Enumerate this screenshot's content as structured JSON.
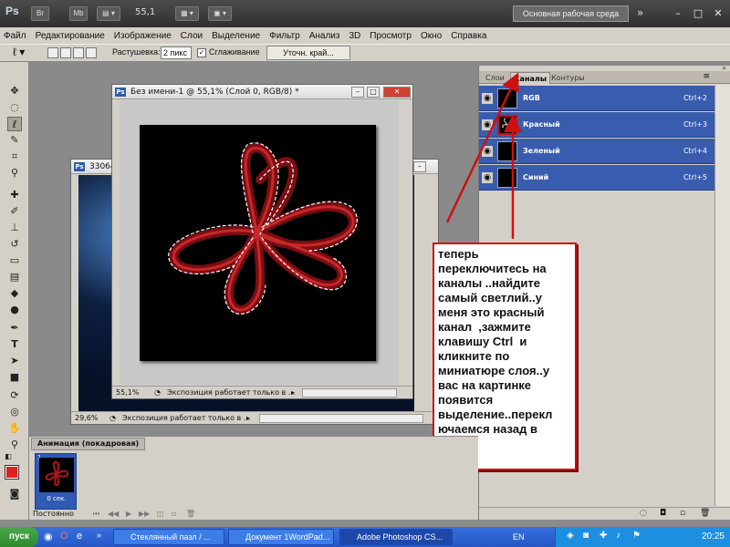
{
  "colors": {
    "accent_red": "#cc1111",
    "channel_blue": "#3a5cae"
  },
  "appbar": {
    "logo": "Ps",
    "bridge_btn": "Br",
    "minibridge_btn": "Mb",
    "zoom": "55,1",
    "workspace": "Основная рабочая среда",
    "more": "»"
  },
  "menu": [
    "Файл",
    "Редактирование",
    "Изображение",
    "Слои",
    "Выделение",
    "Фильтр",
    "Анализ",
    "3D",
    "Просмотр",
    "Окно",
    "Справка"
  ],
  "options": {
    "feather_label": "Растушевка:",
    "feather_value": "2 пикс",
    "antialias_label": "Сглаживание",
    "refine_edge": "Уточн. край..."
  },
  "doc_front": {
    "title": "Без имени-1 @ 55,1% (Слой 0, RGB/8) *",
    "zoom": "55,1%",
    "status": "Экспозиция работает только в ..."
  },
  "doc_back": {
    "title": "33064",
    "zoom": "29,6%",
    "status": "Экспозиция работает только в ..."
  },
  "panel": {
    "tabs": [
      "Слои",
      "Каналы",
      "Контуры"
    ],
    "channels": [
      {
        "name": "RGB",
        "shortcut": "Ctrl+2"
      },
      {
        "name": "Красный",
        "shortcut": "Ctrl+3"
      },
      {
        "name": "Зеленый",
        "shortcut": "Ctrl+4"
      },
      {
        "name": "Синий",
        "shortcut": "Ctrl+5"
      }
    ]
  },
  "callout": {
    "text": "теперь\nпереключитесь на\nканалы ..найдите\nсамый светлий..у\nменя это красный\nканал  ,зажмите\nклавишу Ctrl  и\nкликните по\nминиатюре слоя..у\nвас на картинке\nпоявится\nвыделение..перекл\nючаемся назад в\nслои"
  },
  "animation": {
    "tab": "Анимация (покадровая)",
    "frame_number": "1",
    "frame_delay": "0 сек.",
    "loop": "Постоянно"
  },
  "taskbar": {
    "start": "пуск",
    "tasks": [
      "Стеклянный пазл / ...",
      "Документ 1WordPad...",
      "Adobe Photoshop CS..."
    ],
    "lang": "EN",
    "clock": "20:25"
  }
}
